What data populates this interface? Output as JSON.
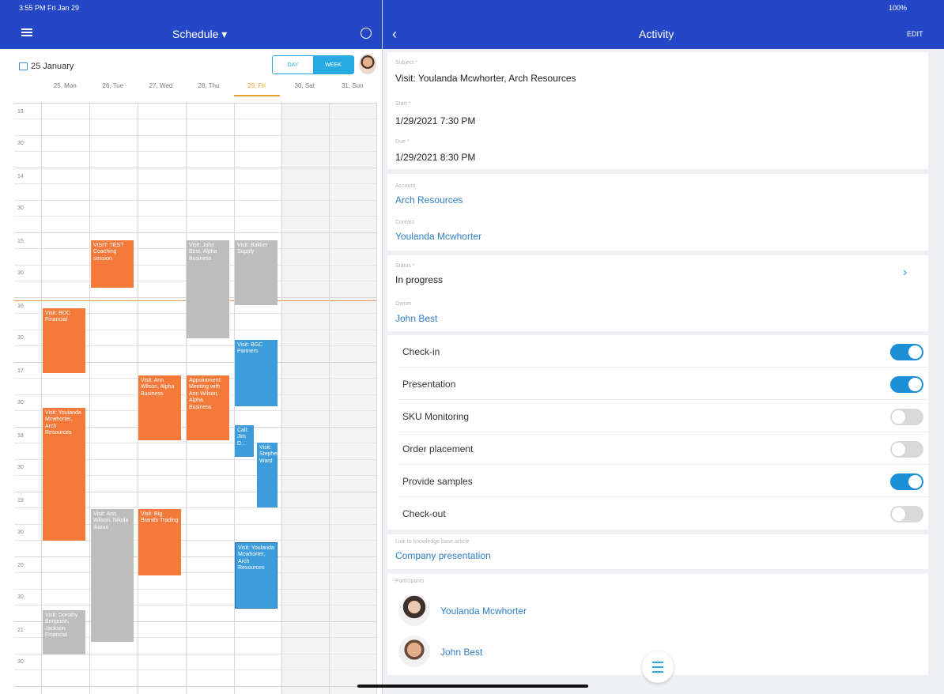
{
  "status_bar": {
    "left": "3:55 PM  Fri Jan 29",
    "right": "100%"
  },
  "schedule": {
    "title": "Schedule ▾",
    "date_label": "25 January",
    "view_day": "DAY",
    "view_week": "WEEK",
    "days": [
      "25, Mon",
      "26, Tue",
      "27, Wed",
      "28, Thu",
      "29, Fri",
      "30, Sat",
      "31, Sun"
    ],
    "hours": [
      "13",
      "30",
      "14",
      "30",
      "15",
      "30",
      "16",
      "30",
      "17",
      "30",
      "18",
      "30",
      "19",
      "30",
      "20",
      "30",
      "21",
      "30"
    ],
    "events": [
      {
        "text": "Visit: BOC Financial",
        "color": "orange"
      },
      {
        "text": "Visit: Youlanda Mcwhorter, Arch Resources",
        "color": "orange"
      },
      {
        "text": "Visit: Dorothy Bergeron, Jackson Financial",
        "color": "gray"
      },
      {
        "text": "VISIT: TEST Coaching session",
        "color": "orange"
      },
      {
        "text": "Visit: Ann Wilson, Nikola Ikarus",
        "color": "gray"
      },
      {
        "text": "Visit: Ann Wilson, Alpha Business",
        "color": "orange"
      },
      {
        "text": "Visit: Big Brands Trading",
        "color": "orange"
      },
      {
        "text": "Visit: John Best, Alpha Business",
        "color": "gray"
      },
      {
        "text": "Appointment: Meeting with Ann Wilson, Alpha Business",
        "color": "orange"
      },
      {
        "text": "Visit: Bakker Supply",
        "color": "gray"
      },
      {
        "text": "Visit: BGC Partners",
        "color": "blue"
      },
      {
        "text": "Call: Jim D...",
        "color": "blue"
      },
      {
        "text": "Visit: Stephen Ward",
        "color": "blue"
      },
      {
        "text": "Visit: Youlanda Mcwhorter, Arch Resources",
        "color": "blue"
      }
    ]
  },
  "activity": {
    "title": "Activity",
    "edit": "EDIT",
    "subject_label": "Subject *",
    "subject": "Visit: Youlanda Mcwhorter, Arch Resources",
    "start_label": "Start *",
    "start": "1/29/2021 7:30 PM",
    "due_label": "Due *",
    "due": "1/29/2021 8:30 PM",
    "account_label": "Account",
    "account": "Arch Resources",
    "contact_label": "Contact",
    "contact": "Youlanda Mcwhorter",
    "status_label": "Status *",
    "status": "In progress",
    "owner_label": "Owner",
    "owner": "John Best",
    "checks": [
      {
        "label": "Check-in",
        "on": true
      },
      {
        "label": "Presentation",
        "on": true
      },
      {
        "label": "SKU Monitoring",
        "on": false
      },
      {
        "label": "Order placement",
        "on": false
      },
      {
        "label": "Provide samples",
        "on": true
      },
      {
        "label": "Check-out",
        "on": false
      }
    ],
    "kb_label": "Link to knowledge base article",
    "kb_value": "Company presentation",
    "participants_label": "Participants",
    "participants": [
      "Youlanda Mcwhorter",
      "John Best"
    ]
  },
  "colors": {
    "header": "#2347c6",
    "orange": "#f47a3c",
    "gray": "#bdbdbd",
    "blue": "#3d9cdb",
    "toggle_on": "#1c8fd7",
    "link": "#2f7ec7"
  }
}
